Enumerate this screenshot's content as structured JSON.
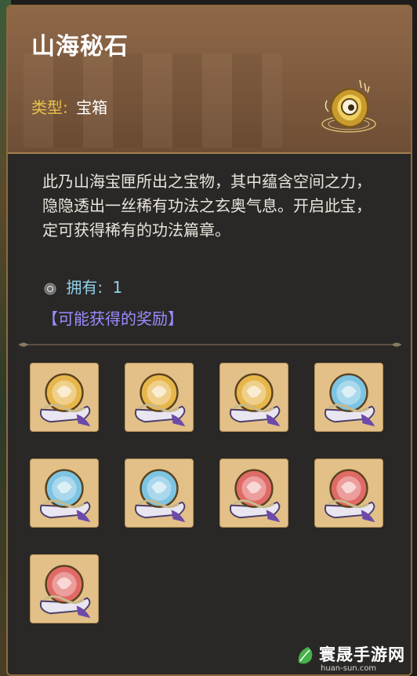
{
  "item": {
    "name": "山海秘石",
    "type_label": "类型:",
    "type_value": "宝箱",
    "icon": "golden-stone-chest-icon"
  },
  "description": "此乃山海宝匣所出之宝物，其中蕴含空间之力，隐隐透出一丝稀有功法之玄奥气息。开启此宝，定可获得稀有的功法篇章。",
  "owned": {
    "label": "拥有:",
    "count": "1",
    "icon": "stone-ring-icon"
  },
  "rewards": {
    "label": "【可能获得的奖励】",
    "items": [
      {
        "icon": "golden-scroll-icon",
        "tint": "#e7b64a"
      },
      {
        "icon": "golden-scroll-icon",
        "tint": "#e7b64a"
      },
      {
        "icon": "golden-scroll-icon",
        "tint": "#e7b64a"
      },
      {
        "icon": "blue-scroll-icon",
        "tint": "#7cc4e2"
      },
      {
        "icon": "blue-scroll-icon",
        "tint": "#7cc4e2"
      },
      {
        "icon": "blue-scroll-icon",
        "tint": "#7cc4e2"
      },
      {
        "icon": "red-scroll-icon",
        "tint": "#e06a66"
      },
      {
        "icon": "red-scroll-icon",
        "tint": "#e06a66"
      },
      {
        "icon": "red-scroll-icon",
        "tint": "#e06a66"
      }
    ]
  },
  "watermark": {
    "text": "寰晟手游网",
    "url": "huan-sun.com"
  },
  "colors": {
    "header": "#7e5a3e",
    "panel": "#2a2826",
    "type_label": "#e8c04b",
    "owned": "#8fd2ea",
    "rewards_label": "#9b8bff"
  }
}
